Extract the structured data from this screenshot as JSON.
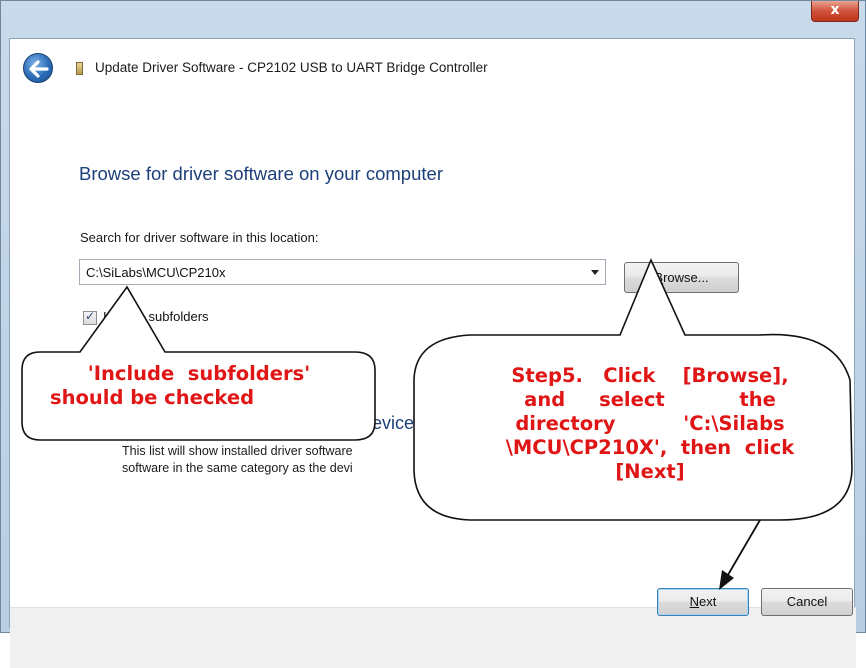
{
  "window": {
    "close_label": "x",
    "title": "Update Driver Software - CP2102 USB to UART Bridge Controller"
  },
  "main": {
    "heading": "Browse for driver software on your computer",
    "search_label": "Search for driver software in this location:",
    "path_value": "C:\\SiLabs\\MCU\\CP210x",
    "browse_button": {
      "accel": "B",
      "rest": "rowse..."
    },
    "include_subfolders": {
      "checked": true,
      "accel": "I",
      "rest": "nclude subfolders"
    },
    "pick_option": {
      "title_partial": "evice",
      "desc_line1_partial": "This list will show installed driver software",
      "desc_line2_partial": "software in the same category as the devi"
    }
  },
  "footer": {
    "next_button": {
      "accel": "N",
      "rest": "ext"
    },
    "cancel_button": "Cancel"
  },
  "annotations": {
    "callout_left": {
      "line1": "'Include  subfolders'",
      "line2": "should be checked"
    },
    "callout_right": {
      "line1": "Step5.   Click    [Browse],",
      "line2": "and     select           the",
      "line3": "directory          'C:\\Silabs",
      "line4": "\\MCU\\CP210X',  then  click",
      "line5": "[Next]"
    },
    "color": "#e01515"
  },
  "icons": {
    "back": "back-arrow-icon",
    "device": "device-icon",
    "dropdown": "chevron-down-icon",
    "check": "checkmark-icon"
  }
}
